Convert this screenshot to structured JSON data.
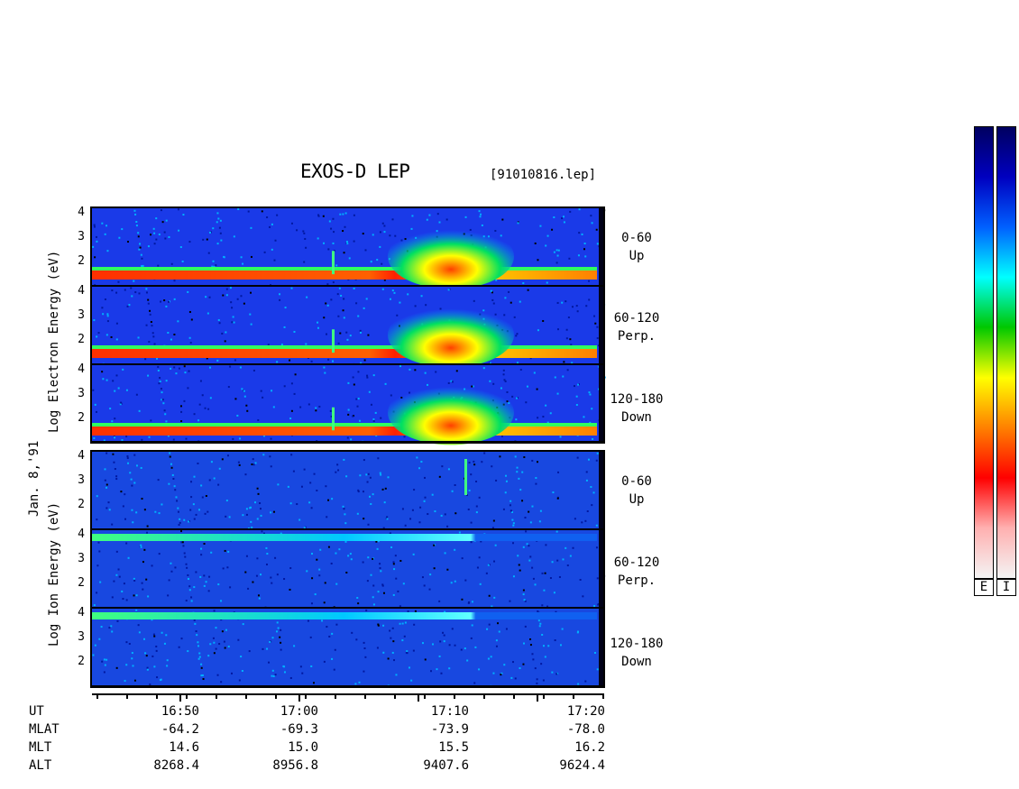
{
  "title": "EXOS-D LEP",
  "file_name": "[91010816.lep]",
  "date_label": "Jan. 8,'91",
  "electron_axis_label": "Log  Electron  Energy (eV)",
  "ion_axis_label": "Log   Ion  Energy (eV)",
  "panels": [
    {
      "angle": "0-60",
      "dir": "Up",
      "species": "electron"
    },
    {
      "angle": "60-120",
      "dir": "Perp.",
      "species": "electron"
    },
    {
      "angle": "120-180",
      "dir": "Down",
      "species": "electron"
    },
    {
      "angle": "0-60",
      "dir": "Up",
      "species": "ion"
    },
    {
      "angle": "60-120",
      "dir": "Perp.",
      "species": "ion"
    },
    {
      "angle": "120-180",
      "dir": "Down",
      "species": "ion"
    }
  ],
  "chart_data": {
    "type": "heatmap",
    "title": "EXOS-D LEP",
    "x_axis": {
      "label": "UT",
      "ticks": [
        "16:50",
        "17:00",
        "17:10",
        "17:20"
      ]
    },
    "y_axis": {
      "label": "Log Energy (eV)",
      "ticks": [
        2,
        3,
        4
      ],
      "ylim": [
        1,
        4.2
      ],
      "scale": "log"
    },
    "colorbars": [
      {
        "label": "E"
      },
      {
        "label": "I"
      }
    ],
    "colormap": [
      "#f4f4f4",
      "#ffb0b0",
      "#ff0000",
      "#ff8000",
      "#ffff00",
      "#00c800",
      "#00ffff",
      "#0060ff",
      "#0000c0",
      "#000060"
    ],
    "ephemeris": {
      "rows": [
        {
          "name": "UT",
          "values": [
            "16:50",
            "17:00",
            "17:10",
            "17:20"
          ]
        },
        {
          "name": "MLAT",
          "values": [
            "-64.2",
            "-69.3",
            "-73.9",
            "-78.0"
          ]
        },
        {
          "name": "MLT",
          "values": [
            "14.6",
            "15.0",
            "15.5",
            "16.2"
          ]
        },
        {
          "name": "ALT",
          "values": [
            "8268.4",
            "8956.8",
            "9407.6",
            "9624.4"
          ]
        }
      ]
    }
  }
}
